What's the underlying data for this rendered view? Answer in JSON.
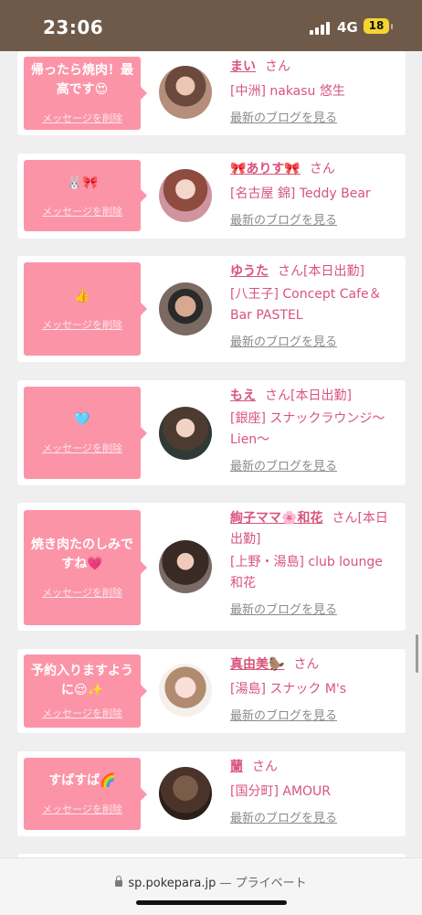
{
  "status_bar": {
    "time": "23:06",
    "network": "4G",
    "battery": "18"
  },
  "cards": [
    {
      "message": "帰ったら焼肉！最高です😍",
      "delete_label": "メッセージを削除",
      "name": "まい",
      "san": "さん",
      "extra": "",
      "shop": "[中洲] nakasu 悠生",
      "blog_label": "最新のブログを見る"
    },
    {
      "message": "🐰🎀",
      "delete_label": "メッセージを削除",
      "name": "🎀ありす🎀",
      "san": "さん",
      "extra": "",
      "shop": "[名古屋 錦] Teddy Bear",
      "blog_label": "最新のブログを見る"
    },
    {
      "message": "👍",
      "delete_label": "メッセージを削除",
      "name": "ゆうた",
      "san": "さん",
      "extra": "[本日出勤]",
      "shop": "[八王子] Concept Cafe＆Bar PASTEL",
      "blog_label": "最新のブログを見る"
    },
    {
      "message": "🩵",
      "delete_label": "メッセージを削除",
      "name": "もえ",
      "san": "さん",
      "extra": "[本日出勤]",
      "shop": "[銀座] スナックラウンジ〜Lien〜",
      "blog_label": "最新のブログを見る"
    },
    {
      "message": "焼き肉たのしみですね💗",
      "delete_label": "メッセージを削除",
      "name": "絢子ママ🌸和花",
      "san": "さん",
      "extra": "[本日出勤]",
      "shop": "[上野・湯島] club lounge 和花",
      "blog_label": "最新のブログを見る"
    },
    {
      "message": "予約入りますように😌✨",
      "delete_label": "メッセージを削除",
      "name": "真由美🦫",
      "san": "さん",
      "extra": "",
      "shop": "[湯島] スナック M's",
      "blog_label": "最新のブログを見る"
    },
    {
      "message": "すばすば🌈",
      "delete_label": "メッセージを削除",
      "name": "蘭",
      "san": "さん",
      "extra": "",
      "shop": "[国分町] AMOUR",
      "blog_label": "最新のブログを見る"
    }
  ],
  "browser": {
    "url": "sp.pokepara.jp",
    "separator": " — ",
    "mode": "プライベート"
  }
}
